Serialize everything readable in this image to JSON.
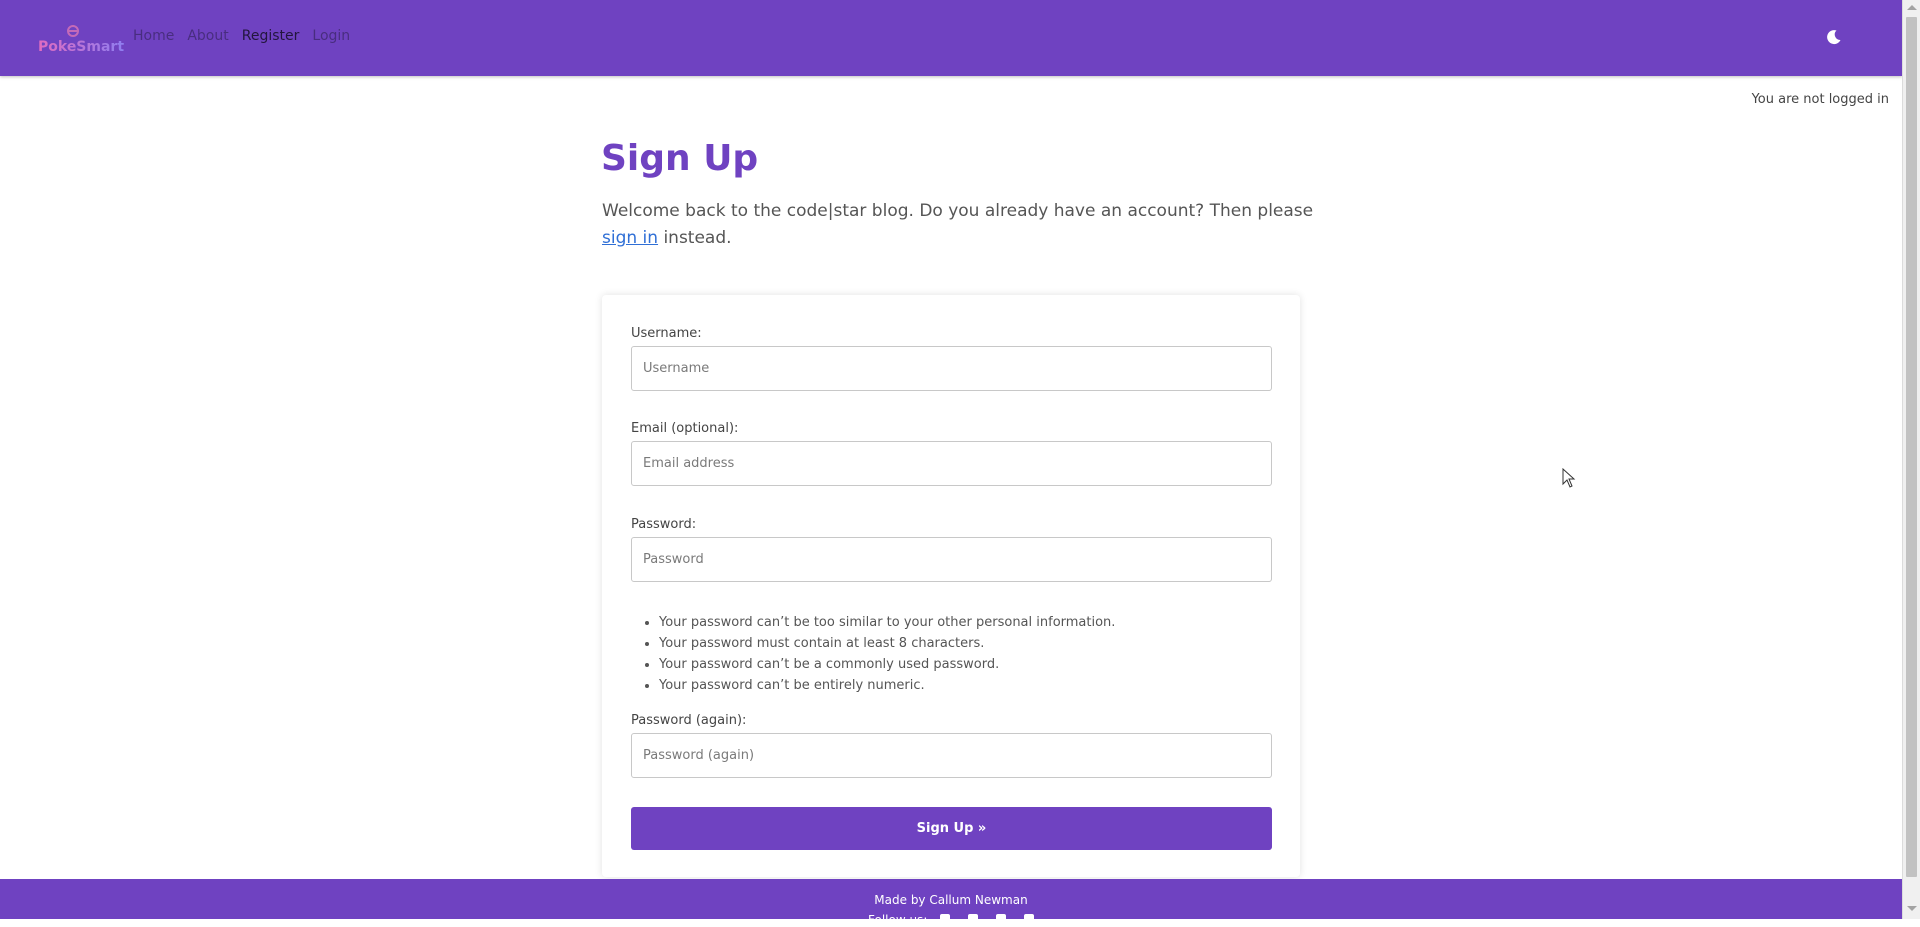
{
  "brand": {
    "name": "PokeSmart"
  },
  "nav": {
    "items": [
      {
        "label": "Home"
      },
      {
        "label": "About"
      },
      {
        "label": "Register"
      },
      {
        "label": "Login"
      }
    ]
  },
  "theme_toggle": {
    "icon": "moon-icon"
  },
  "status": {
    "text": "You are not logged in"
  },
  "page": {
    "title": "Sign Up",
    "intro_before": "Welcome back to the code|star blog. Do you already have an account? Then please ",
    "intro_link": "sign in",
    "intro_after": " instead."
  },
  "form": {
    "username": {
      "label": "Username:",
      "placeholder": "Username",
      "value": ""
    },
    "email": {
      "label": "Email (optional):",
      "placeholder": "Email address",
      "value": ""
    },
    "password": {
      "label": "Password:",
      "placeholder": "Password",
      "value": ""
    },
    "password_help": [
      "Your password can’t be too similar to your other personal information.",
      "Your password must contain at least 8 characters.",
      "Your password can’t be a commonly used password.",
      "Your password can’t be entirely numeric."
    ],
    "password2": {
      "label": "Password (again):",
      "placeholder": "Password (again)",
      "value": ""
    },
    "submit_label": "Sign Up »"
  },
  "footer": {
    "credit": "Made by Callum Newman",
    "follow": "Follow us:",
    "social_icons": [
      "facebook-icon",
      "twitter-icon",
      "instagram-icon",
      "youtube-icon"
    ]
  },
  "colors": {
    "primary": "#6f42c1",
    "link": "#2f6fd6"
  }
}
